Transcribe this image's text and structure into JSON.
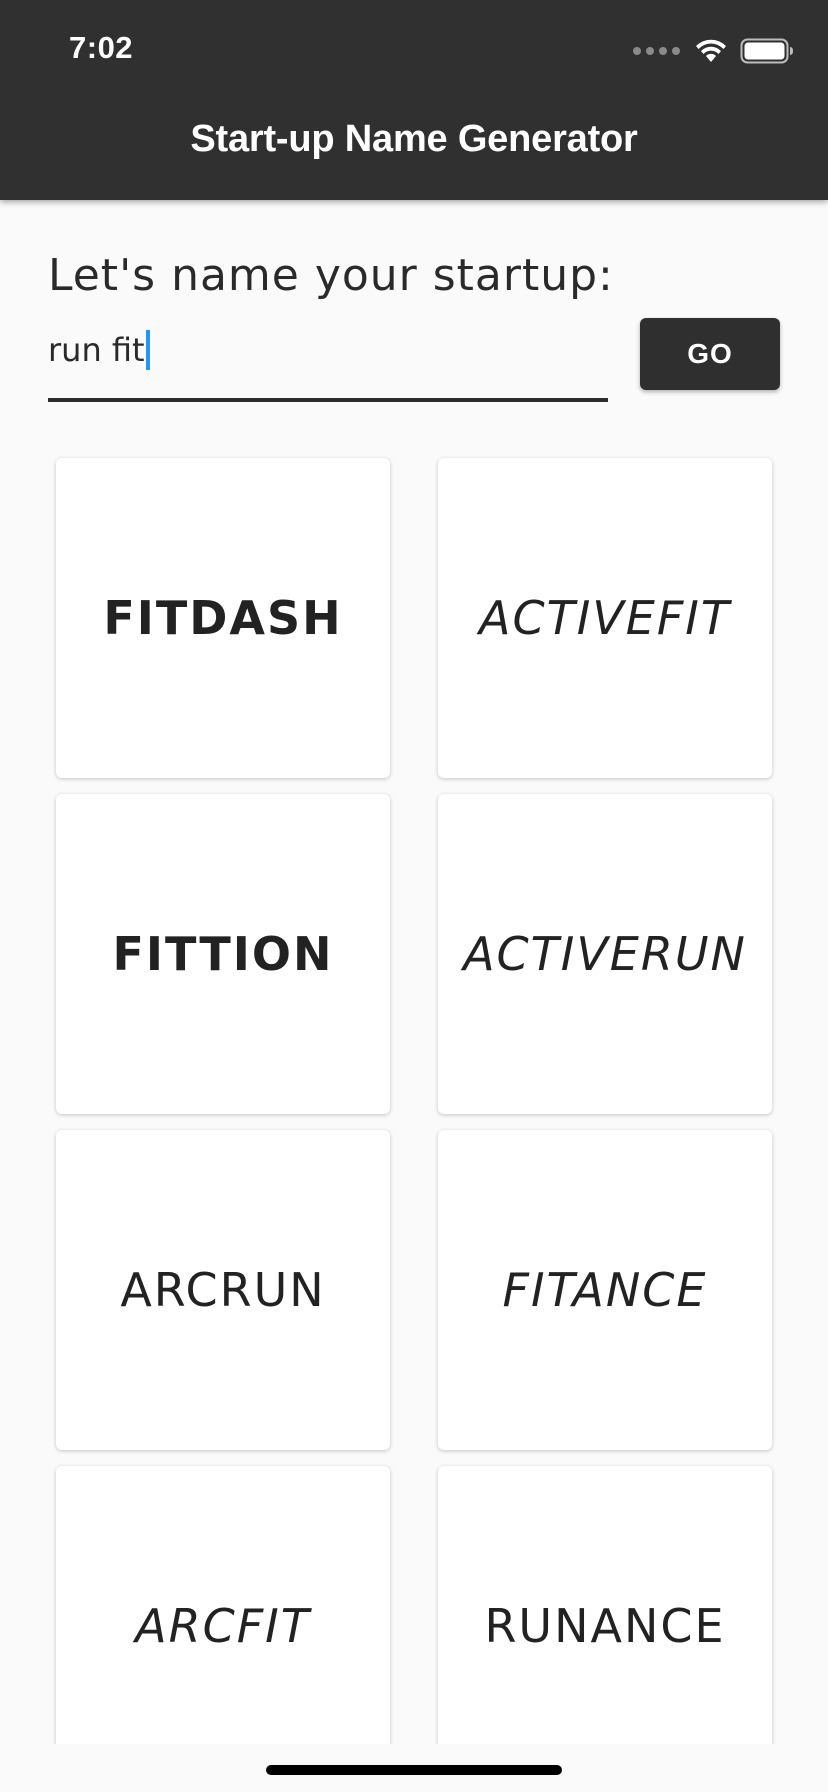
{
  "status_bar": {
    "time": "7:02"
  },
  "app_bar": {
    "title": "Start-up Name Generator"
  },
  "form": {
    "prompt": "Let's name your startup:",
    "input_value": "run fit",
    "go_label": "GO"
  },
  "names": [
    {
      "label": "FITDASH",
      "style": "bold"
    },
    {
      "label": "ACTIVEFIT",
      "style": "italic"
    },
    {
      "label": "FITTION",
      "style": "bold"
    },
    {
      "label": "ACTIVERUN",
      "style": "italic"
    },
    {
      "label": "ARCRUN",
      "style": "regular"
    },
    {
      "label": "FITANCE",
      "style": "italic"
    },
    {
      "label": "ARCFIT",
      "style": "italic"
    },
    {
      "label": "RUNANCE",
      "style": "regular"
    }
  ],
  "colors": {
    "app_bar": "#303030",
    "background": "#fafafa",
    "caret": "#2196f3",
    "button": "#2f2f2f"
  }
}
